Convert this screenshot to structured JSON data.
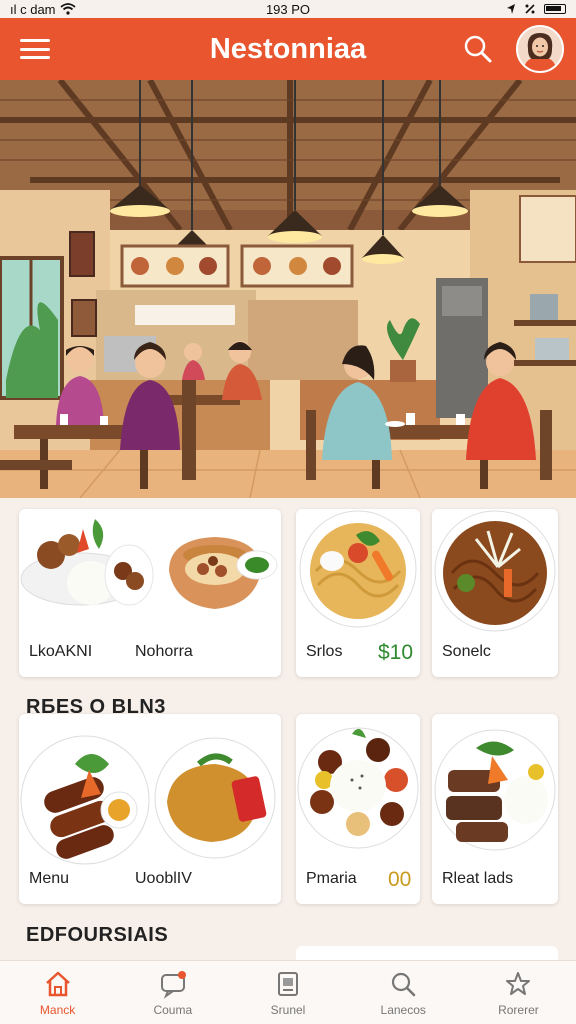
{
  "status_bar": {
    "carrier": "ıl c dam",
    "time": "193 PO"
  },
  "header": {
    "title": "Nestonniaa",
    "menu_icon": "hamburger-icon",
    "search_icon": "search-icon",
    "avatar": "user-avatar"
  },
  "colors": {
    "brand": "#e8552e",
    "price_green": "#2e8a2e",
    "price_gold": "#c99a1e"
  },
  "cards_row1": [
    {
      "left_label": "LkoAKNI",
      "right_label": "Nohorra"
    },
    {
      "label": "Srlos",
      "price": "$10"
    },
    {
      "label": "Sonelc"
    }
  ],
  "section2": {
    "title": "RБES O BLN3"
  },
  "cards_row2": [
    {
      "left_label": "Menu",
      "right_label": "UooblIV"
    },
    {
      "label": "Pmaria",
      "price": "00"
    },
    {
      "label": "Rleat lads"
    }
  ],
  "section3": {
    "title": "EDFOURSIAIS"
  },
  "nav": [
    {
      "label": "Manck",
      "icon": "home-icon",
      "active": true
    },
    {
      "label": "Couma",
      "icon": "chat-icon",
      "active": false
    },
    {
      "label": "Srunel",
      "icon": "document-icon",
      "active": false
    },
    {
      "label": "Lanecos",
      "icon": "search-icon",
      "active": false
    },
    {
      "label": "Rorerer",
      "icon": "star-icon",
      "active": false
    }
  ]
}
